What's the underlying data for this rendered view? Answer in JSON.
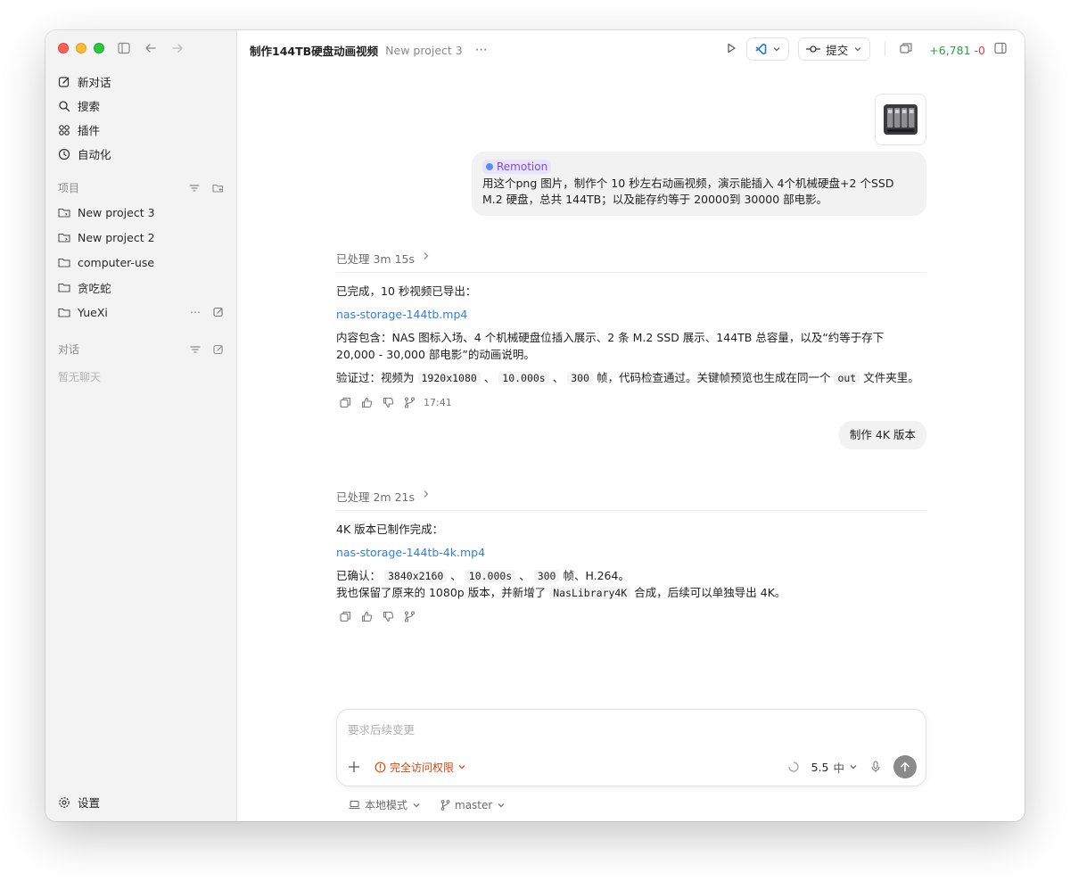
{
  "window": {
    "title": "制作144TB硬盘动画视频",
    "project": "New project 3"
  },
  "sidebar": {
    "nav": [
      {
        "label": "新对话",
        "icon": "edit-icon"
      },
      {
        "label": "搜索",
        "icon": "search-icon"
      },
      {
        "label": "插件",
        "icon": "grid-icon"
      },
      {
        "label": "自动化",
        "icon": "clock-icon"
      }
    ],
    "projects_heading": "项目",
    "projects": [
      {
        "label": "New project 3"
      },
      {
        "label": "New project 2"
      },
      {
        "label": "computer-use"
      },
      {
        "label": "贪吃蛇"
      },
      {
        "label": "YueXi"
      }
    ],
    "chats_heading": "对话",
    "empty_chats": "暂无聊天",
    "settings_label": "设置"
  },
  "header": {
    "commit_label": "提交",
    "diff_plus": "+6,781",
    "diff_minus": "-0"
  },
  "messages": {
    "user1": {
      "tag": "Remotion",
      "text": "用这个png 图片，制作个 10 秒左右动画视频，演示能插入 4个机械硬盘+2 个SSD M.2 硬盘，总共 144TB；以及能存约等于  20000到 30000 部电影。"
    },
    "proc1": "已处理 3m 15s",
    "reply1": {
      "line1": "已完成，10 秒视频已导出：",
      "link": "nas-storage-144tb.mp4",
      "content": "内容包含：NAS 图标入场、4 个机械硬盘位插入展示、2 条 M.2 SSD 展示、144TB 总容量，以及“约等于存下 20,000 - 30,000 部电影”的动画说明。",
      "verify_prefix": "验证过：视频为",
      "res": "1920x1080",
      "dur": "10.000s",
      "frames": "300",
      "verify_suffix": "帧，代码检查通过。关键帧预览也生成在同一个",
      "folder": "out",
      "folder_suffix": "文件夹里。",
      "time": "17:41"
    },
    "user2": "制作 4K 版本",
    "proc2": "已处理 2m 21s",
    "reply2": {
      "line1": "4K 版本已制作完成：",
      "link": "nas-storage-144tb-4k.mp4",
      "confirm_prefix": "已确认：",
      "res": "3840x2160",
      "dur": "10.000s",
      "frames": "300",
      "confirm_suffix": "帧、H.264。",
      "keep_prefix": "我也保留了原来的 1080p 版本，并新增了",
      "comp": "NasLibrary4K",
      "keep_suffix": "合成，后续可以单独导出 4K。"
    }
  },
  "composer": {
    "placeholder": "要求后续变更",
    "access_label": "完全访问权限",
    "model": "5.5",
    "effort": "中"
  },
  "footer": {
    "mode": "本地模式",
    "branch": "master"
  }
}
